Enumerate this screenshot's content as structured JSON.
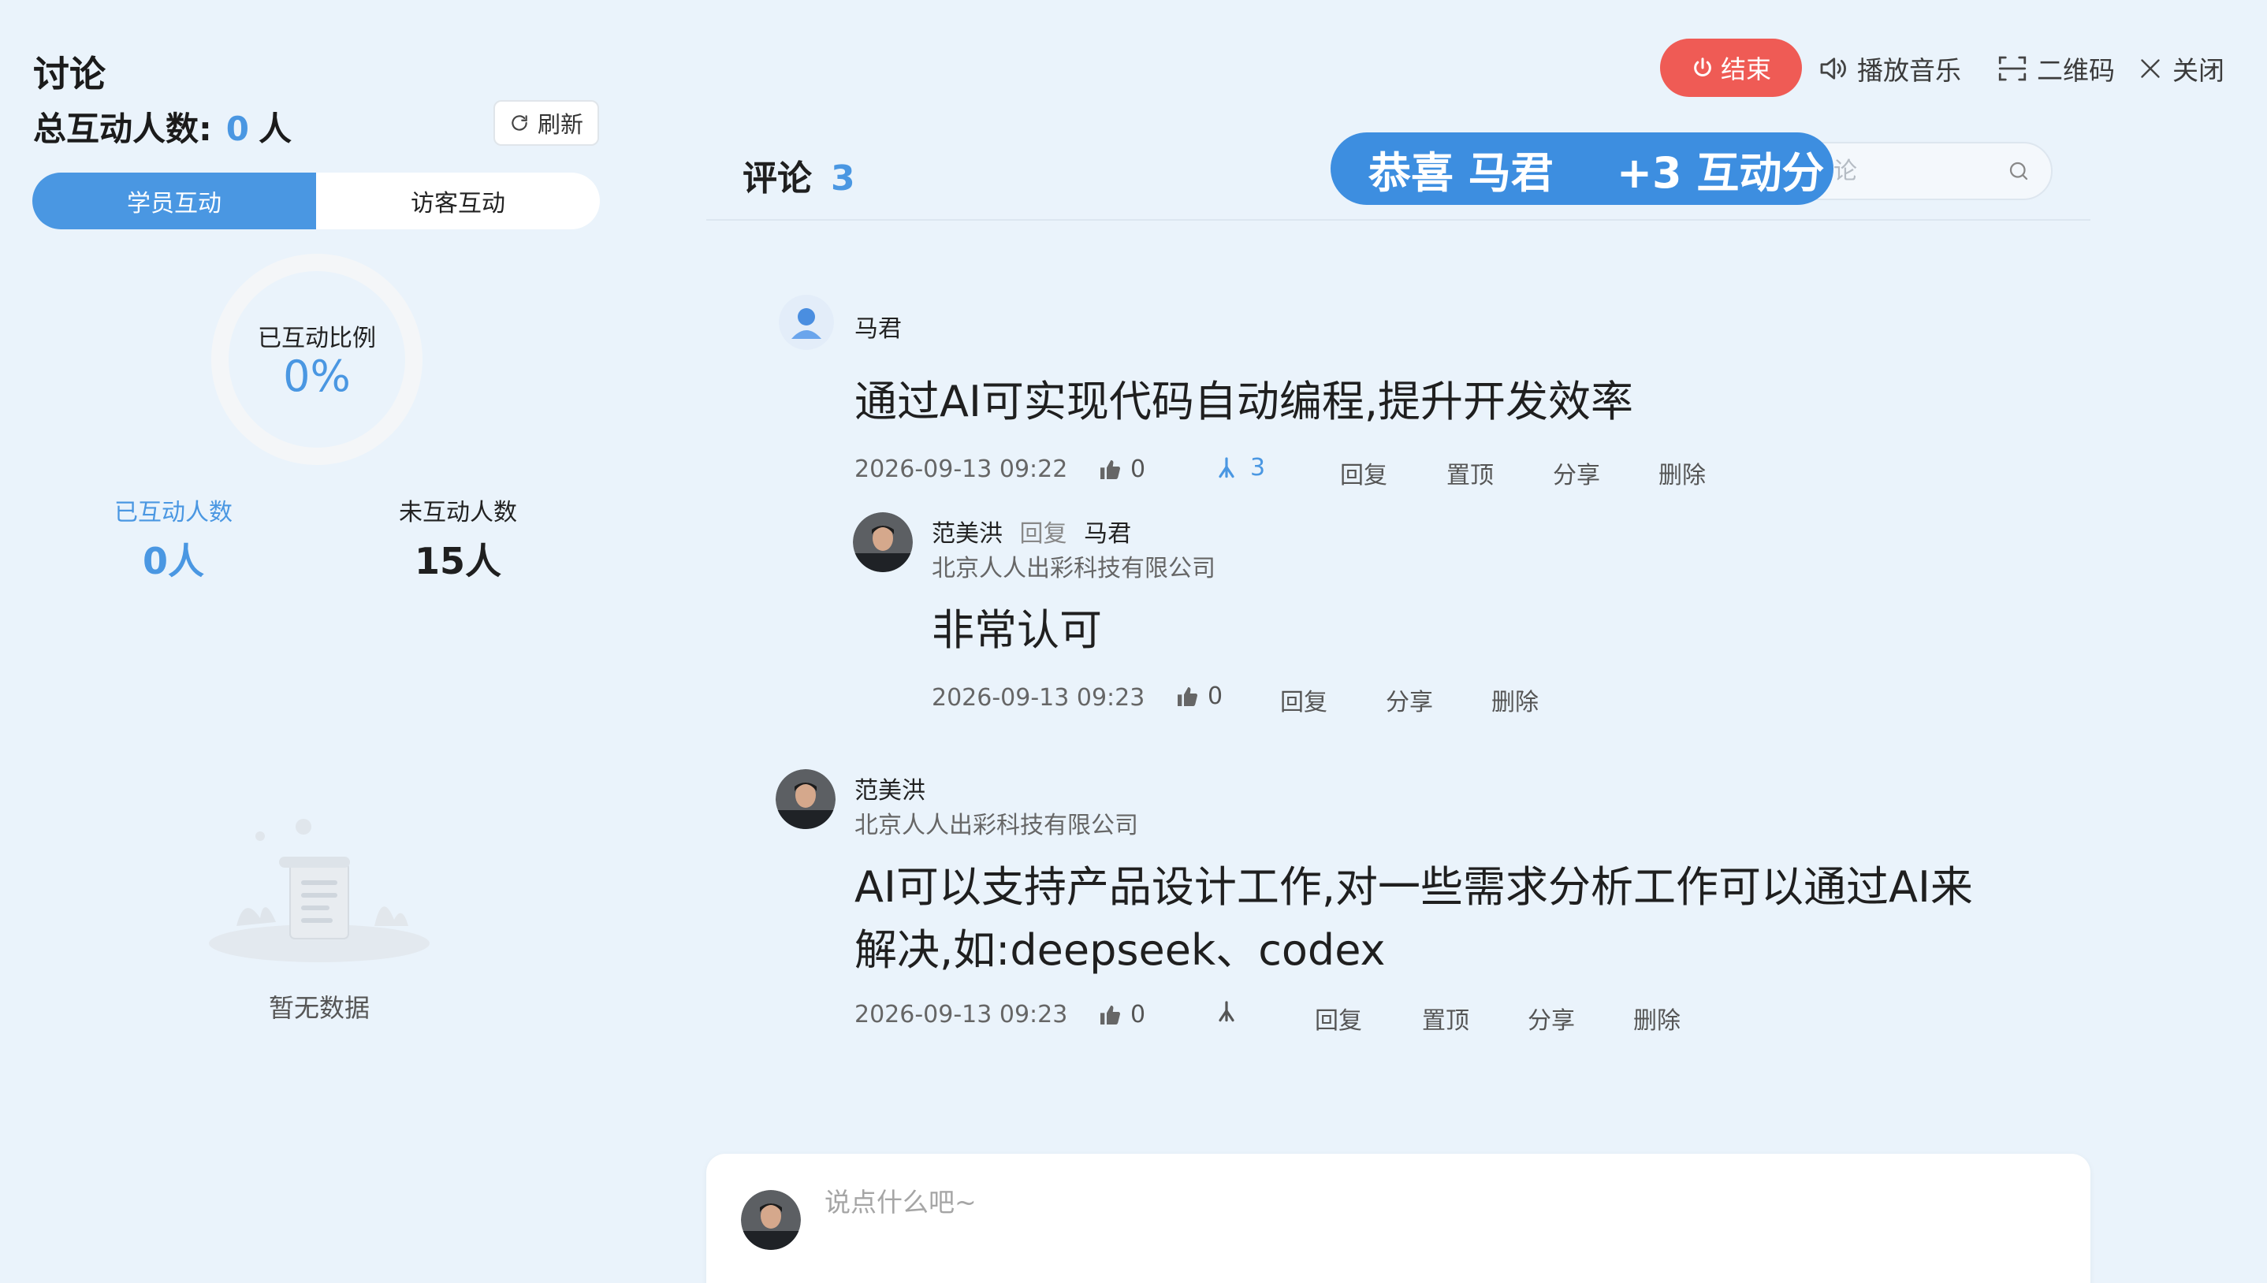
{
  "panel": {
    "title": "讨论",
    "total_label": "总互动人数:",
    "total_count": "0",
    "total_unit": "人",
    "refresh_label": "刷新",
    "tabs": [
      "学员互动",
      "访客互动"
    ],
    "ring_label": "已互动比例",
    "ring_value": "0%",
    "ring_fraction": 0,
    "interacted_label": "已互动人数",
    "interacted_value": "0人",
    "not_interacted_label": "未互动人数",
    "not_interacted_value": "15人",
    "empty_text": "暂无数据"
  },
  "toolbar": {
    "end_label": "结束",
    "music_label": "播放音乐",
    "qrcode_label": "二维码",
    "close_label": "关闭"
  },
  "comments": {
    "title": "评论",
    "count": "3",
    "search_placeholder": "评论",
    "banner": {
      "text": "恭喜 马君",
      "points": "+3 互动分"
    },
    "actions": {
      "reply": "回复",
      "pin": "置顶",
      "share": "分享",
      "delete": "删除"
    },
    "items": [
      {
        "author": "马君",
        "text": "通过AI可实现代码自动编程,提升开发效率",
        "time": "2026-09-13 09:22",
        "likes": "0",
        "reply_count": "3",
        "reply": {
          "author": "范美洪",
          "reply_word": "回复",
          "reply_to": "马君",
          "company": "北京人人出彩科技有限公司",
          "text": "非常认可",
          "time": "2026-09-13 09:23",
          "likes": "0"
        }
      },
      {
        "author": "范美洪",
        "company": "北京人人出彩科技有限公司",
        "text_line1": "AI可以支持产品设计工作,对一些需求分析工作可以通过AI来",
        "text_line2": "解决,如:deepseek、codex",
        "time": "2026-09-13 09:23",
        "likes": "0"
      }
    ]
  },
  "input": {
    "placeholder": "说点什么吧~"
  },
  "colors": {
    "accent": "#4a97e2",
    "end_button": "#ef5b55",
    "background": "#eaf3fb"
  }
}
